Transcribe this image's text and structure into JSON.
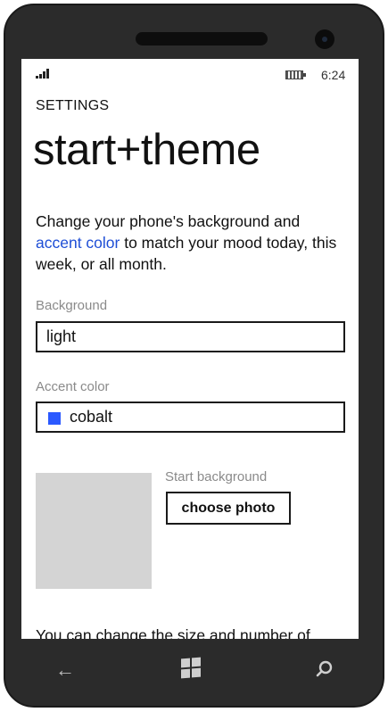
{
  "status_bar": {
    "time": "6:24",
    "signal_icon": "signal-strength-icon",
    "battery_icon": "battery-icon"
  },
  "header": {
    "section": "SETTINGS",
    "title": "start+theme"
  },
  "description": {
    "before_link": "Change your phone's background and ",
    "link_text": "accent color",
    "after_link": " to match your mood today, this week, or all month."
  },
  "background": {
    "label": "Background",
    "value": "light"
  },
  "accent": {
    "label": "Accent color",
    "value": "cobalt",
    "swatch_color": "#2b59ff"
  },
  "start_background": {
    "label": "Start background",
    "button_label": "choose photo"
  },
  "footer_text": "You can change the size and number of",
  "nav": {
    "back_icon": "back-arrow-icon",
    "start_icon": "windows-logo-icon",
    "search_icon": "search-icon"
  },
  "colors": {
    "accent_link": "#1f4fd6",
    "phone_body": "#2b2b2b",
    "muted_label": "#8a8a8a"
  }
}
